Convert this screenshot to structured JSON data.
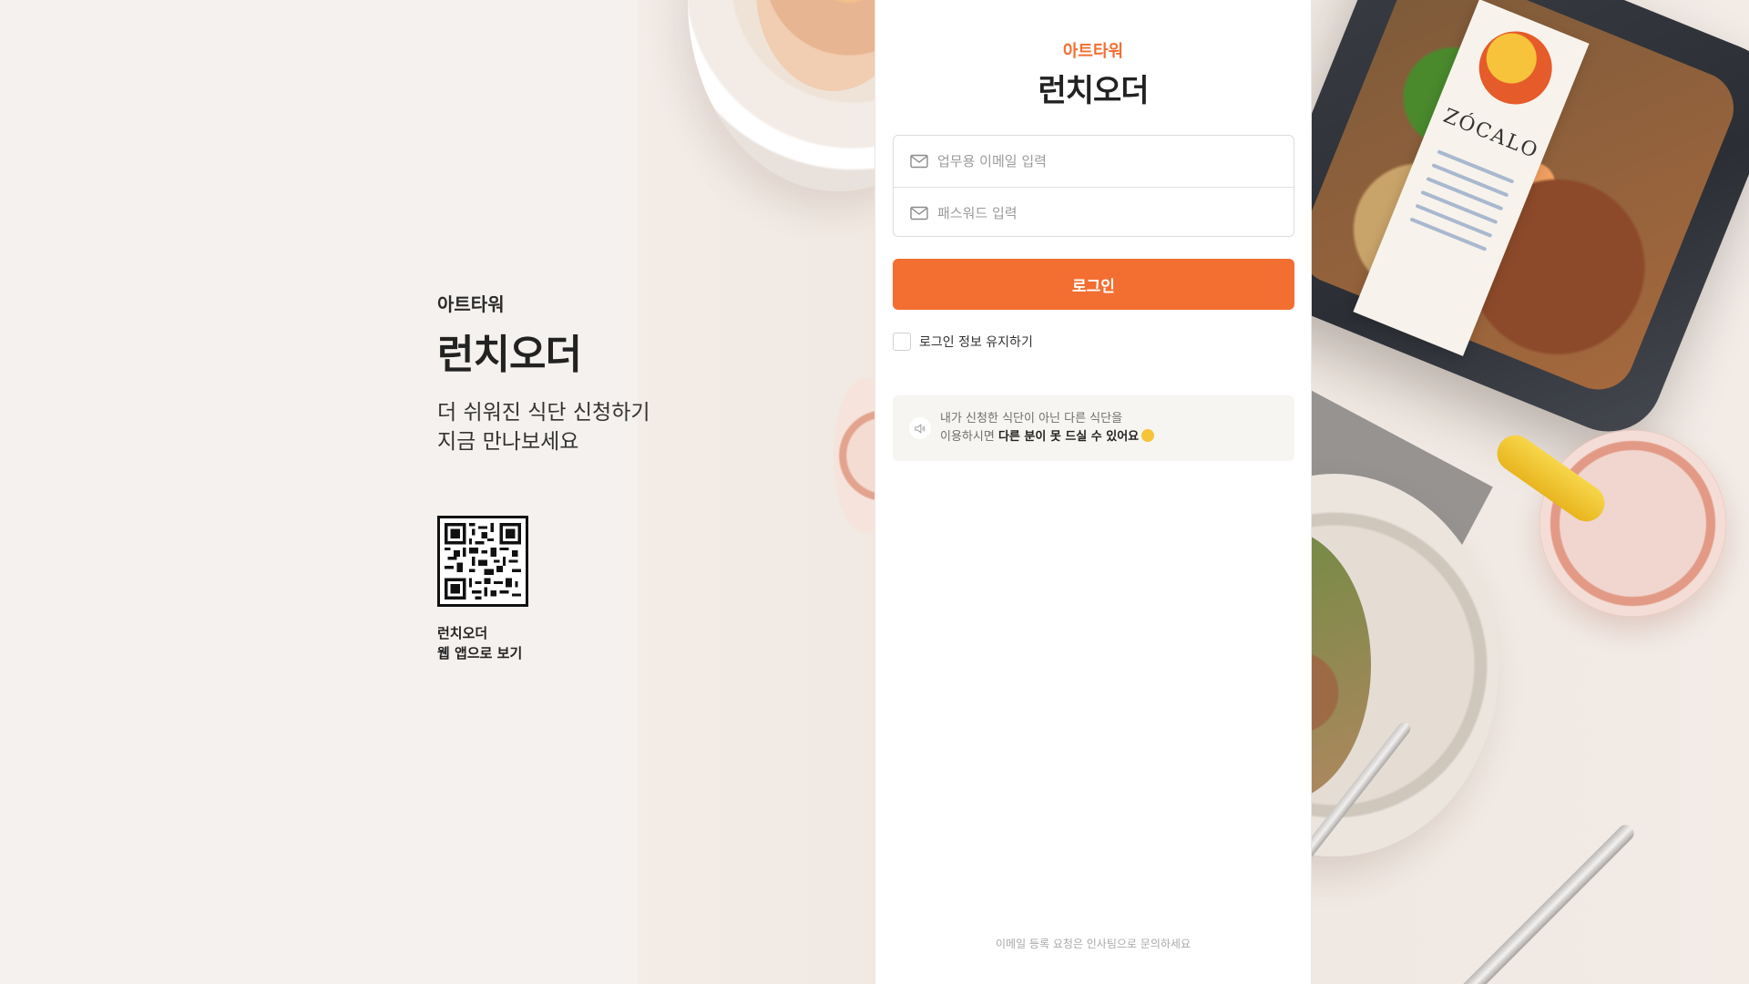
{
  "promo": {
    "org": "아트타워",
    "title": "런치오더",
    "subtitle_line1": "더 쉬워진 식단 신청하기",
    "subtitle_line2": "지금 만나보세요",
    "qr_caption_line1": "런치오더",
    "qr_caption_line2": "웹 앱으로 보기"
  },
  "login": {
    "org": "아트타워",
    "app_name": "런치오더",
    "email_placeholder": "업무용 이메일 입력",
    "email_value": "",
    "password_placeholder": "패스워드 입력",
    "password_value": "",
    "login_button": "로그인",
    "remember_label": "로그인 정보 유지하기",
    "remember_checked": false,
    "notice_line1": "내가 신청한 식단이 아닌 다른 식단을",
    "notice_line2_prefix": "이용하시면 ",
    "notice_line2_bold": "다른 분이 못 드실 수 있어요",
    "footer": "이메일 등록 요청은 인사팀으로 문의하세요"
  },
  "colors": {
    "accent": "#f36e31",
    "panel_bg": "#ffffff",
    "notice_bg": "#f7f5f1"
  },
  "icons": {
    "email": "mail-icon",
    "password": "mail-icon",
    "notice": "speaker-icon",
    "emoji": "worried-face-emoji"
  }
}
